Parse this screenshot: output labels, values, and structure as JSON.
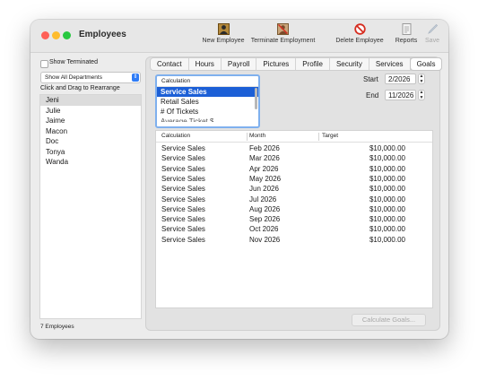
{
  "window": {
    "title": "Employees"
  },
  "toolbar": {
    "new_employee": "New Employee",
    "terminate_employment": "Terminate Employment",
    "delete_employee": "Delete Employee",
    "reports": "Reports",
    "save": "Save"
  },
  "sidebar": {
    "show_terminated_label": "Show Terminated",
    "show_terminated_checked": false,
    "department_filter": "Show All Departments",
    "drag_hint": "Click and Drag to Rearrange",
    "employees": [
      "Jeni",
      "Julie",
      "Jaime",
      "Macon",
      "Doc",
      "Tonya",
      "Wanda"
    ],
    "selected_employee": "Jeni",
    "count_label": "7 Employees"
  },
  "tabs": {
    "items": [
      "Contact",
      "Hours",
      "Payroll",
      "Pictures",
      "Profile",
      "Security",
      "Services",
      "Goals"
    ],
    "active": "Goals"
  },
  "calculation_list": {
    "header": "Calculation",
    "items": [
      "Service Sales",
      "Retail Sales",
      "# Of Tickets",
      "Average Ticket $"
    ],
    "selected": "Service Sales"
  },
  "date_range": {
    "start_label": "Start",
    "start_value": "2/2026",
    "end_label": "End",
    "end_value": "11/2026"
  },
  "goals_table": {
    "columns": [
      "Calculation",
      "Month",
      "Target"
    ],
    "rows": [
      [
        "Service Sales",
        "Feb 2026",
        "$10,000.00"
      ],
      [
        "Service Sales",
        "Mar 2026",
        "$10,000.00"
      ],
      [
        "Service Sales",
        "Apr 2026",
        "$10,000.00"
      ],
      [
        "Service Sales",
        "May 2026",
        "$10,000.00"
      ],
      [
        "Service Sales",
        "Jun 2026",
        "$10,000.00"
      ],
      [
        "Service Sales",
        "Jul 2026",
        "$10,000.00"
      ],
      [
        "Service Sales",
        "Aug 2026",
        "$10,000.00"
      ],
      [
        "Service Sales",
        "Sep 2026",
        "$10,000.00"
      ],
      [
        "Service Sales",
        "Oct 2026",
        "$10,000.00"
      ],
      [
        "Service Sales",
        "Nov 2026",
        "$10,000.00"
      ]
    ]
  },
  "calculate_button": "Calculate Goals...",
  "colors": {
    "accent": "#1c5fd6",
    "select_arrow": "#2f7cf6",
    "focus_ring": "#7fb0ee"
  }
}
